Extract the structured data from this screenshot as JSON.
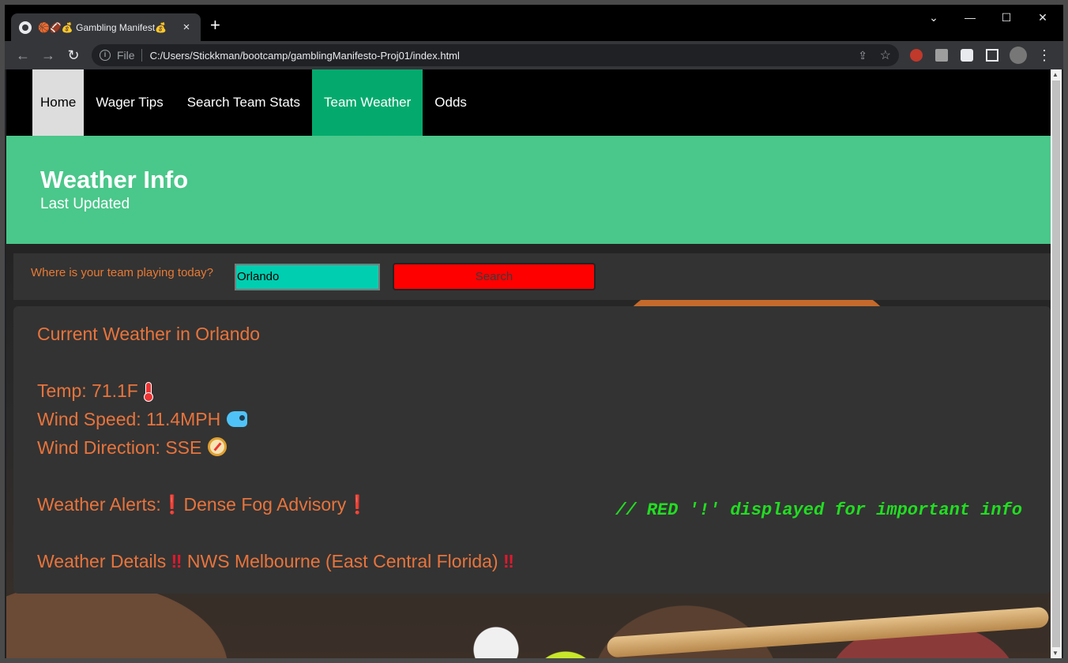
{
  "browser": {
    "tab_title": "🏀🏈💰 Gambling Manifest💰",
    "tab_close": "×",
    "new_tab": "+",
    "minimize": "—",
    "maximize": "☐",
    "close_window": "✕",
    "tab_list": "⌄",
    "scheme_label": "File",
    "url": "C:/Users/Stickkman/bootcamp/gamblingManifesto-Proj01/index.html"
  },
  "nav": {
    "items": [
      {
        "label": "Home"
      },
      {
        "label": "Wager Tips"
      },
      {
        "label": "Search Team Stats"
      },
      {
        "label": "Team Weather"
      },
      {
        "label": "Odds"
      }
    ],
    "active": "Team Weather"
  },
  "hero": {
    "title": "Weather Info",
    "subtitle": "Last Updated"
  },
  "search": {
    "label": "Where is your team playing today?",
    "value": "Orlando",
    "button_label": "Search"
  },
  "weather": {
    "heading": "Current Weather in Orlando",
    "temp": "Temp: 71.1F",
    "wind_speed": "Wind Speed: 11.4MPH",
    "wind_direction": "Wind Direction: SSE",
    "alerts_label": "Weather Alerts:",
    "alerts_value": "Dense Fog Advisory",
    "details_label": "Weather Details",
    "details_value": "NWS Melbourne (East Central Florida)",
    "single_mark": "❗",
    "double_mark": "‼",
    "note": "// RED '!' displayed for important info"
  },
  "colors": {
    "nav_active": "#04aa6d",
    "hero_bg": "#4ac78a",
    "text_orange": "#e8743c",
    "search_button": "#ff0000",
    "input_bg": "#00ceb0",
    "note_green": "#22dd22"
  },
  "icons": [
    "globe-icon",
    "thermometer-icon",
    "wind-icon",
    "compass-icon",
    "info-icon",
    "share-icon",
    "star-icon",
    "extensions-icon",
    "sidepanel-icon",
    "profile-avatar",
    "menu-icon"
  ]
}
